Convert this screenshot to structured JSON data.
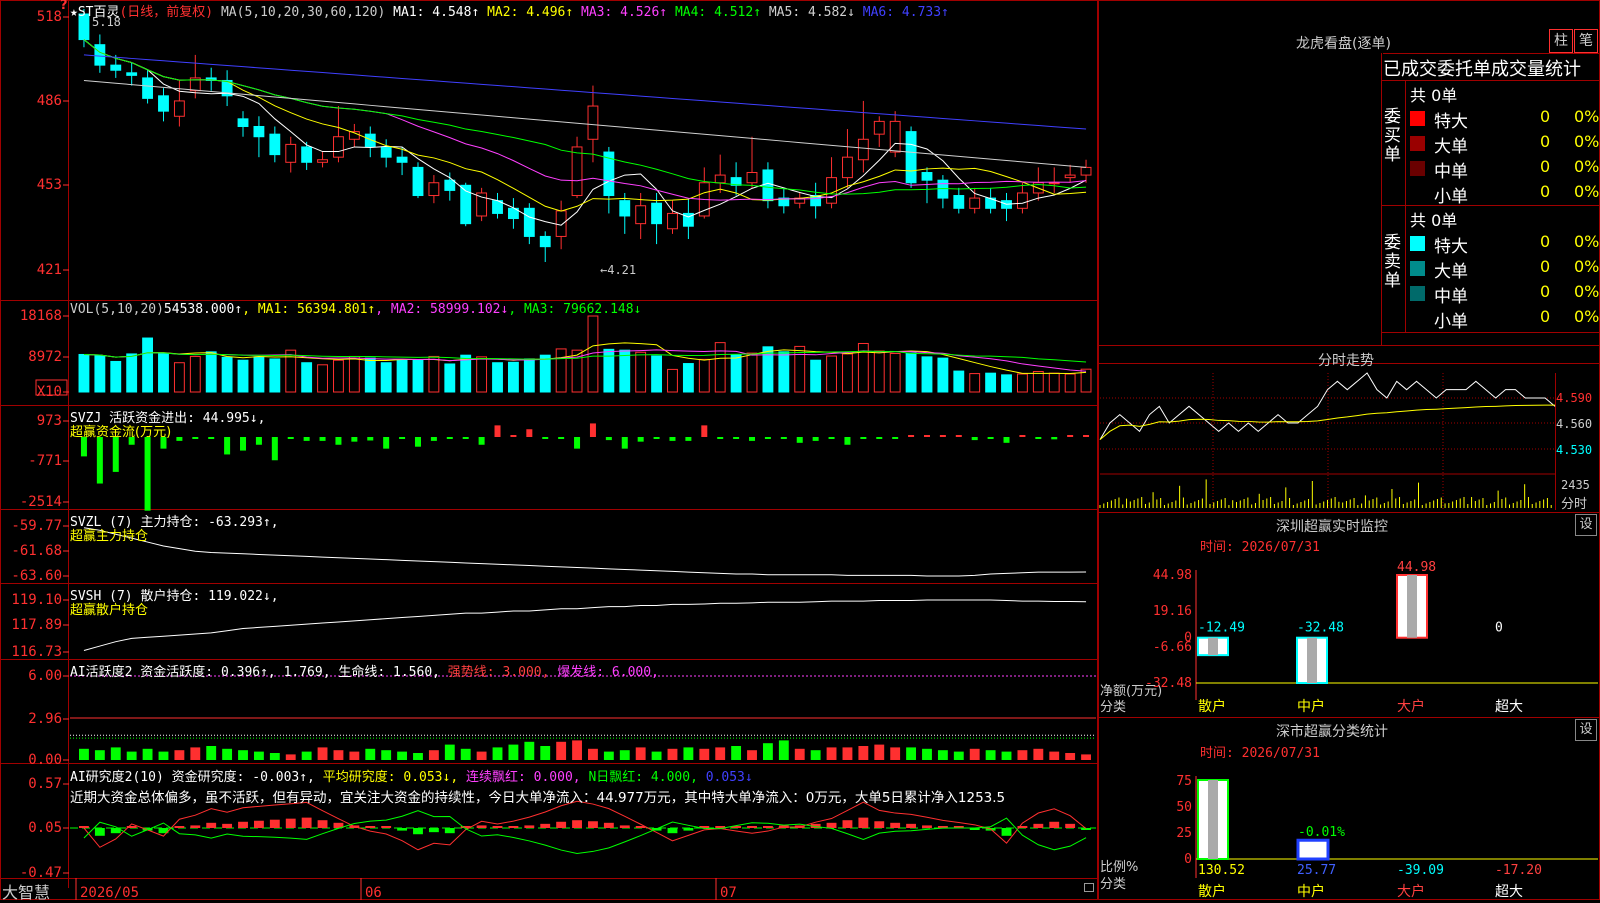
{
  "stock": {
    "name": "★ST百灵",
    "mode": "(日线，前复权)",
    "high_mark": "5.18",
    "low_mark": "←4.21",
    "corner": "?"
  },
  "indicators": {
    "ma_label": "MA(5,10,20,30,60,120)",
    "ma": [
      {
        "t": "MA1: 4.548↑",
        "c": "#ffffff"
      },
      {
        "t": "MA2: 4.496↑",
        "c": "#ffff00"
      },
      {
        "t": "MA3: 4.526↑",
        "c": "#ff40ff"
      },
      {
        "t": "MA4: 4.512↑",
        "c": "#00ff00"
      },
      {
        "t": "MA5: 4.582↓",
        "c": "#d0d0d0"
      },
      {
        "t": "MA6: 4.733↑",
        "c": "#4040ff"
      }
    ],
    "vol": [
      {
        "t": "VOL(5,10,20)",
        "c": "#cccccc"
      },
      {
        "t": "54538.000↑",
        "c": "#ffffff"
      },
      {
        "t": ", MA1: 56394.801↑",
        "c": "#ffff00"
      },
      {
        "t": ", MA2: 58999.102↓",
        "c": "#ff40ff"
      },
      {
        "t": ", MA3: 79662.148↓",
        "c": "#00ff00"
      }
    ],
    "svzj": [
      {
        "t": "SVZJ  活跃资金进出: 44.995↓,",
        "c": "#ffffff"
      }
    ],
    "svzj_sub": "超赢资金流(万元)",
    "svzl": "SVZL (7) 主力持仓: -63.293↑,",
    "svzl_sub": "超赢主力持仓",
    "svsh": "SVSH (7) 散户持仓: 119.022↓,",
    "svsh_sub": "超赢散户持仓",
    "ai2": [
      {
        "t": "AI活跃度2 资金活跃度: 0.396↑, 1.769, 生命线: 1.560,",
        "c": "#ffffff"
      },
      {
        "t": " 强势线: 3.000,",
        "c": "#ff4040"
      },
      {
        "t": " 爆发线: 6.000,",
        "c": "#ff40ff"
      }
    ],
    "ai_res": [
      {
        "t": "AI研究度2(10) 资金研究度: -0.003↑,",
        "c": "#ffffff"
      },
      {
        "t": " 平均研究度: 0.053↓,",
        "c": "#ffff00"
      },
      {
        "t": " 连续飘红: 0.000,",
        "c": "#ff40ff"
      },
      {
        "t": " N日飘红: 4.000,",
        "c": "#00ff00"
      },
      {
        "t": " 0.053↓",
        "c": "#4040ff"
      }
    ],
    "ai_text": "近期大资金总体偏多，虽不活跃，但有异动，宜关注大资金的持续性，今日大单净流入：44.977万元，其中特大单净流入：0万元，大单5日累计净入1253.5"
  },
  "axes": {
    "price": [
      "518",
      "486",
      "453",
      "421"
    ],
    "vol": [
      "18168",
      "8972",
      "X10"
    ],
    "svzj": [
      "973",
      "-771",
      "-2514"
    ],
    "svzl": [
      "-59.77",
      "-61.68",
      "-63.60"
    ],
    "svsh": [
      "119.10",
      "117.89",
      "116.73"
    ],
    "ai2": [
      "6.00",
      "2.96",
      "0.00"
    ],
    "ai_res": [
      "0.57",
      "0.05",
      "-0.47"
    ],
    "dates": [
      "2026/05",
      "06",
      "07"
    ]
  },
  "brand": "大智慧",
  "longhu": {
    "title": "龙虎看盘(逐单)",
    "btn1": "柱",
    "btn2": "笔",
    "subtitle": "已成交委托单成交量统计",
    "buy_label": "委买单",
    "sell_label": "委卖单",
    "buy": {
      "total": "共 0单",
      "rows": [
        {
          "n": "特大",
          "v": "0",
          "p": "0%",
          "c": "#ff0000"
        },
        {
          "n": "大单",
          "v": "0",
          "p": "0%",
          "c": "#9a0000"
        },
        {
          "n": "中单",
          "v": "0",
          "p": "0%",
          "c": "#6a0000"
        },
        {
          "n": "小单",
          "v": "0",
          "p": "0%",
          "c": "#000000"
        }
      ]
    },
    "sell": {
      "total": "共 0单",
      "rows": [
        {
          "n": "特大",
          "v": "0",
          "p": "0%",
          "c": "#00ffff"
        },
        {
          "n": "大单",
          "v": "0",
          "p": "0%",
          "c": "#008c8c"
        },
        {
          "n": "中单",
          "v": "0",
          "p": "0%",
          "c": "#006a6a"
        },
        {
          "n": "小单",
          "v": "0",
          "p": "0%",
          "c": "#000000"
        }
      ]
    }
  },
  "fenshi": {
    "title": "分时走势",
    "prices": [
      "4.590",
      "4.560",
      "4.530"
    ],
    "vol_top": "2435",
    "vol_label": "分时"
  },
  "monitor": {
    "title": "深圳超赢实时监控",
    "btn": "设",
    "time": "时间: 2026/07/31",
    "y": [
      "44.98",
      "19.16",
      "0",
      "-6.66",
      "-32.48"
    ],
    "ylabel": "净额(万元)",
    "xlabel": "分类",
    "cats": [
      {
        "n": "散户",
        "v": "-12.49",
        "c": "#00ffff"
      },
      {
        "n": "中户",
        "v": "-32.48",
        "c": "#00ffff"
      },
      {
        "n": "大户",
        "v": "44.98",
        "c": "#ff4040"
      },
      {
        "n": "超大",
        "v": "0",
        "c": "#ffffff"
      }
    ],
    "cat_colors": [
      "#ffff00",
      "#ffff00",
      "#ff4040",
      "#ffffff"
    ]
  },
  "classify": {
    "title": "深市超赢分类统计",
    "btn": "设",
    "time": "时间: 2026/07/31",
    "y": [
      "75",
      "50",
      "25",
      "0"
    ],
    "ylabel": "比例%",
    "xlabel": "分类",
    "mid_label": "-0.01%",
    "values": [
      {
        "n": "散户",
        "v": "130.52",
        "c": "#ffff00"
      },
      {
        "n": "中户",
        "v": "25.77",
        "c": "#4060ff"
      },
      {
        "n": "大户",
        "v": "-39.09",
        "c": "#00ffff"
      },
      {
        "n": "超大",
        "v": "-17.20",
        "c": "#ff4040"
      }
    ]
  },
  "chart_data": {
    "type": "bar",
    "title": "★ST百灵 (日线，前复权)",
    "x_dates": [
      "2026/05",
      "06",
      "07"
    ],
    "price_range": [
      4.21,
      5.18
    ],
    "ma_last": {
      "MA1": 4.548,
      "MA2": 4.496,
      "MA3": 4.526,
      "MA4": 4.512,
      "MA5": 4.582,
      "MA6": 4.733
    },
    "candles": [
      [
        5.18,
        5.08,
        5.2,
        5.05
      ],
      [
        5.06,
        4.98,
        5.1,
        4.95
      ],
      [
        4.98,
        4.96,
        5.02,
        4.93
      ],
      [
        4.95,
        4.94,
        4.99,
        4.9
      ],
      [
        4.93,
        4.85,
        4.96,
        4.83
      ],
      [
        4.86,
        4.8,
        4.89,
        4.76
      ],
      [
        4.78,
        4.84,
        4.92,
        4.74
      ],
      [
        4.88,
        4.93,
        5.02,
        4.85
      ],
      [
        4.93,
        4.92,
        4.97,
        4.88
      ],
      [
        4.92,
        4.86,
        4.96,
        4.82
      ],
      [
        4.77,
        4.74,
        4.8,
        4.7
      ],
      [
        4.74,
        4.7,
        4.78,
        4.62
      ],
      [
        4.71,
        4.63,
        4.74,
        4.6
      ],
      [
        4.6,
        4.67,
        4.7,
        4.56
      ],
      [
        4.66,
        4.6,
        4.68,
        4.57
      ],
      [
        4.6,
        4.61,
        4.64,
        4.58
      ],
      [
        4.62,
        4.7,
        4.82,
        4.6
      ],
      [
        4.69,
        4.72,
        4.75,
        4.66
      ],
      [
        4.71,
        4.66,
        4.74,
        4.62
      ],
      [
        4.66,
        4.62,
        4.69,
        4.58
      ],
      [
        4.62,
        4.6,
        4.66,
        4.55
      ],
      [
        4.58,
        4.47,
        4.6,
        4.46
      ],
      [
        4.47,
        4.52,
        4.55,
        4.44
      ],
      [
        4.53,
        4.49,
        4.56,
        4.45
      ],
      [
        4.51,
        4.36,
        4.52,
        4.35
      ],
      [
        4.39,
        4.48,
        4.5,
        4.37
      ],
      [
        4.45,
        4.4,
        4.48,
        4.38
      ],
      [
        4.42,
        4.38,
        4.46,
        4.34
      ],
      [
        4.42,
        4.31,
        4.44,
        4.28
      ],
      [
        4.31,
        4.27,
        4.33,
        4.21
      ],
      [
        4.31,
        4.41,
        4.45,
        4.26
      ],
      [
        4.47,
        4.66,
        4.7,
        4.46
      ],
      [
        4.69,
        4.82,
        4.9,
        4.6
      ],
      [
        4.64,
        4.47,
        4.66,
        4.4
      ],
      [
        4.45,
        4.39,
        4.48,
        4.32
      ],
      [
        4.36,
        4.43,
        4.48,
        4.3
      ],
      [
        4.44,
        4.36,
        4.48,
        4.28
      ],
      [
        4.34,
        4.4,
        4.45,
        4.32
      ],
      [
        4.4,
        4.35,
        4.46,
        4.3
      ],
      [
        4.39,
        4.52,
        4.58,
        4.38
      ],
      [
        4.52,
        4.55,
        4.63,
        4.48
      ],
      [
        4.54,
        4.51,
        4.6,
        4.47
      ],
      [
        4.52,
        4.56,
        4.7,
        4.5
      ],
      [
        4.57,
        4.45,
        4.6,
        4.42
      ],
      [
        4.46,
        4.43,
        4.5,
        4.4
      ],
      [
        4.44,
        4.46,
        4.48,
        4.42
      ],
      [
        4.47,
        4.43,
        4.52,
        4.38
      ],
      [
        4.44,
        4.54,
        4.62,
        4.42
      ],
      [
        4.54,
        4.62,
        4.73,
        4.5
      ],
      [
        4.61,
        4.69,
        4.84,
        4.56
      ],
      [
        4.71,
        4.76,
        4.78,
        4.66
      ],
      [
        4.64,
        4.76,
        4.8,
        4.62
      ],
      [
        4.72,
        4.52,
        4.74,
        4.5
      ],
      [
        4.56,
        4.53,
        4.58,
        4.44
      ],
      [
        4.53,
        4.46,
        4.55,
        4.42
      ],
      [
        4.47,
        4.42,
        4.5,
        4.4
      ],
      [
        4.42,
        4.46,
        4.5,
        4.4
      ],
      [
        4.46,
        4.42,
        4.5,
        4.4
      ],
      [
        4.45,
        4.42,
        4.48,
        4.37
      ],
      [
        4.42,
        4.48,
        4.52,
        4.4
      ],
      [
        4.48,
        4.52,
        4.58,
        4.45
      ],
      [
        4.52,
        4.52,
        4.58,
        4.48
      ],
      [
        4.54,
        4.55,
        4.59,
        4.52
      ],
      [
        4.55,
        4.58,
        4.61,
        4.52
      ]
    ],
    "volume": [
      8972,
      8700,
      7300,
      9100,
      12900,
      9100,
      7000,
      8500,
      9600,
      8300,
      7600,
      8400,
      7900,
      10000,
      7000,
      6500,
      7600,
      8500,
      8100,
      7000,
      7600,
      7600,
      8500,
      6700,
      8800,
      8400,
      7000,
      7100,
      7900,
      8800,
      10300,
      10000,
      18168,
      10200,
      10000,
      9500,
      8600,
      5400,
      6800,
      7800,
      11800,
      8900,
      9300,
      10800,
      9600,
      10900,
      7600,
      8600,
      9100,
      11600,
      9800,
      9200,
      9300,
      8400,
      8100,
      5000,
      4400,
      4500,
      4100,
      4300,
      4900,
      4500,
      4300,
      5454
    ],
    "svzj": [
      -500,
      -1200,
      -900,
      -200,
      -1900,
      -300,
      -100,
      -30,
      -40,
      -450,
      -350,
      -200,
      -600,
      -30,
      -100,
      -100,
      -200,
      -120,
      -90,
      -300,
      -50,
      -250,
      -100,
      -30,
      -30,
      -200,
      300,
      20,
      200,
      -50,
      -30,
      -300,
      350,
      -80,
      -300,
      -120,
      -30,
      -100,
      -100,
      300,
      -50,
      -30,
      -100,
      -30,
      -30,
      -150,
      -100,
      -30,
      -200,
      -50,
      -30,
      -20,
      30,
      20,
      10,
      10,
      -80,
      -30,
      -150,
      20,
      -20,
      -60,
      0,
      40,
      450
    ],
    "svzl": [
      -59.9,
      -60.1,
      -60.4,
      -60.7,
      -61.0,
      -61.3,
      -61.5,
      -61.7,
      -61.8,
      -61.85,
      -61.9,
      -61.95,
      -62.0,
      -62.05,
      -62.1,
      -62.15,
      -62.2,
      -62.25,
      -62.3,
      -62.35,
      -62.4,
      -62.45,
      -62.5,
      -62.55,
      -62.6,
      -62.65,
      -62.7,
      -62.75,
      -62.8,
      -62.85,
      -62.9,
      -62.95,
      -63.0,
      -63.05,
      -63.1,
      -63.15,
      -63.2,
      -63.25,
      -63.3,
      -63.35,
      -63.4,
      -63.45,
      -63.45,
      -63.5,
      -63.5,
      -63.5,
      -63.5,
      -63.5,
      -63.55,
      -63.55,
      -63.55,
      -63.55,
      -63.55,
      -63.6,
      -63.6,
      -63.6,
      -63.55,
      -63.45,
      -63.4,
      -63.35,
      -63.3,
      -63.3,
      -63.3,
      -63.29
    ],
    "svsh": [
      116.8,
      117.0,
      117.2,
      117.35,
      117.4,
      117.45,
      117.5,
      117.55,
      117.6,
      117.7,
      117.8,
      117.85,
      117.9,
      117.95,
      118.0,
      118.05,
      118.1,
      118.15,
      118.2,
      118.25,
      118.3,
      118.35,
      118.4,
      118.45,
      118.5,
      118.5,
      118.55,
      118.6,
      118.6,
      118.65,
      118.7,
      118.7,
      118.75,
      118.8,
      118.8,
      118.85,
      118.85,
      118.9,
      118.9,
      118.92,
      118.95,
      118.95,
      118.97,
      119.0,
      119.0,
      119.0,
      119.02,
      119.05,
      119.05,
      119.05,
      119.08,
      119.08,
      119.08,
      119.1,
      119.1,
      119.1,
      119.1,
      119.1,
      119.08,
      119.05,
      119.05,
      119.03,
      119.03,
      119.02
    ],
    "ai2": [
      0.8,
      0.7,
      0.9,
      0.6,
      0.8,
      0.6,
      0.7,
      0.9,
      1.0,
      0.8,
      0.7,
      0.6,
      0.5,
      0.4,
      0.6,
      0.9,
      0.7,
      0.6,
      0.8,
      0.7,
      0.6,
      0.5,
      0.7,
      1.1,
      0.8,
      0.6,
      0.9,
      1.1,
      1.3,
      1.0,
      1.3,
      1.4,
      0.8,
      0.6,
      0.7,
      0.9,
      0.6,
      0.8,
      0.9,
      0.8,
      0.9,
      1.0,
      0.7,
      1.2,
      1.4,
      0.8,
      0.7,
      0.9,
      0.9,
      1.0,
      1.1,
      0.9,
      0.9,
      0.8,
      0.7,
      0.6,
      0.8,
      0.7,
      0.6,
      0.7,
      0.8,
      0.6,
      0.5,
      0.4
    ],
    "ai_res": [
      0.0,
      -0.15,
      -0.1,
      0.0,
      -0.05,
      -0.1,
      0.02,
      0.05,
      0.1,
      0.08,
      0.12,
      0.14,
      0.16,
      0.18,
      0.2,
      0.15,
      0.1,
      0.05,
      0.02,
      0.0,
      -0.05,
      -0.12,
      -0.08,
      -0.1,
      0.0,
      0.05,
      0.02,
      0.03,
      0.05,
      0.08,
      0.12,
      0.15,
      0.13,
      0.1,
      0.05,
      0.0,
      -0.05,
      -0.1,
      -0.05,
      0.0,
      0.02,
      0.01,
      0.0,
      0.02,
      0.05,
      0.05,
      0.08,
      0.1,
      0.15,
      0.2,
      0.13,
      0.1,
      0.08,
      0.05,
      0.02,
      0.0,
      -0.02,
      -0.05,
      -0.15,
      0.0,
      0.08,
      0.12,
      0.08,
      -0.003
    ],
    "fenshi_price": [
      4.54,
      4.56,
      4.57,
      4.56,
      4.55,
      4.57,
      4.58,
      4.56,
      4.57,
      4.58,
      4.57,
      4.56,
      4.55,
      4.56,
      4.55,
      4.56,
      4.55,
      4.56,
      4.57,
      4.56,
      4.56,
      4.57,
      4.58,
      4.6,
      4.61,
      4.6,
      4.61,
      4.62,
      4.6,
      4.59,
      4.61,
      4.6,
      4.61,
      4.6,
      4.59,
      4.6,
      4.6,
      4.6,
      4.61,
      4.6,
      4.59,
      4.6,
      4.6,
      4.59,
      4.59,
      4.59,
      4.58
    ],
    "monitor_values": {
      "散户": -12.49,
      "中户": -32.48,
      "大户": 44.98,
      "超大": 0
    },
    "classify_values": {
      "散户": 130.52,
      "中户": 25.77,
      "大户": -39.09,
      "超大": -17.2
    }
  }
}
